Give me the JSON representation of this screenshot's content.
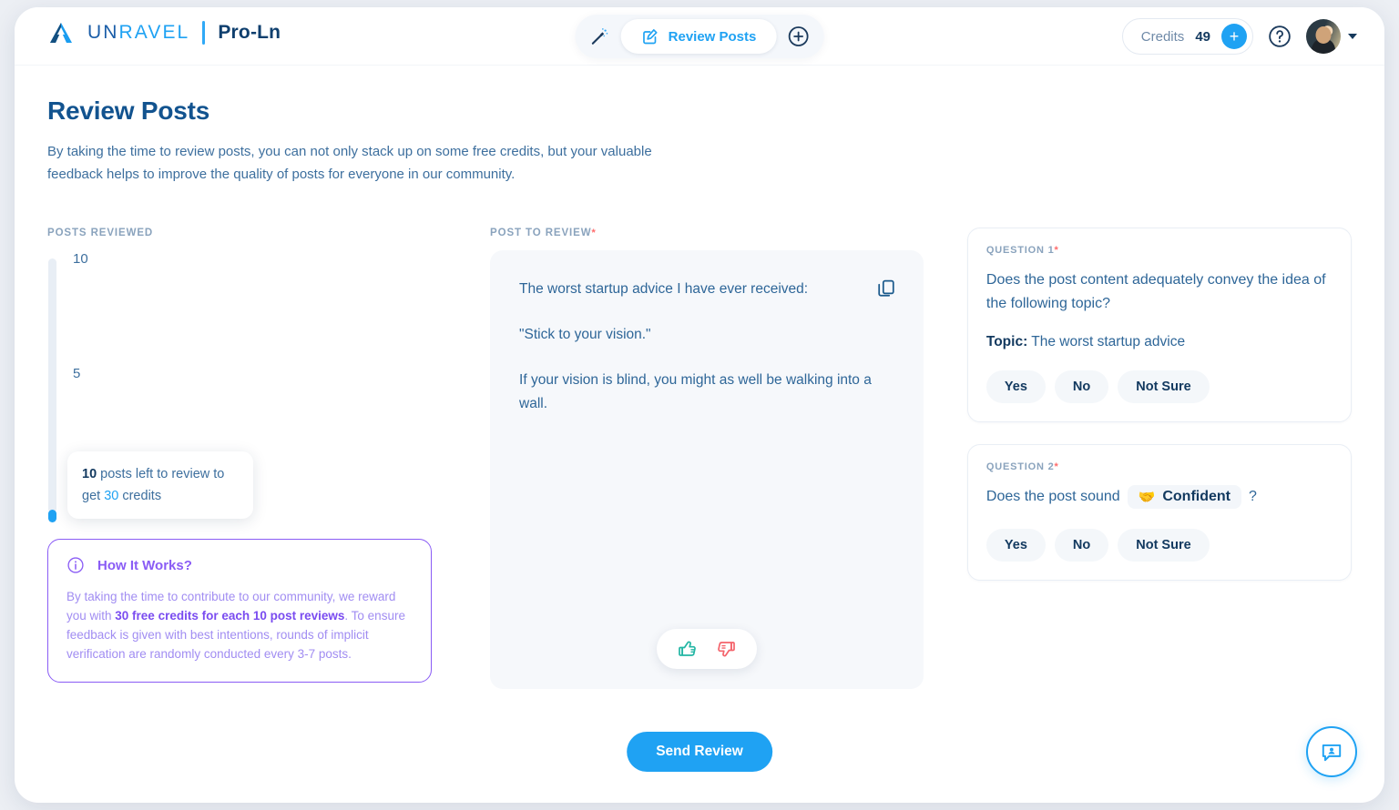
{
  "brand": {
    "word_un": "UN",
    "word_ravel": "RAVEL",
    "product": "Pro-Ln",
    "logo_icon": "unravel-logo-icon"
  },
  "header": {
    "nav": {
      "wand_icon": "magic-wand-icon",
      "tab_label": "Review Posts",
      "tab_icon": "edit-square-icon",
      "add_icon": "plus-circle-icon"
    },
    "credits": {
      "label": "Credits",
      "value": "49",
      "add_symbol": "+"
    },
    "help_icon": "question-mark-circle-icon",
    "avatar": "user-avatar",
    "caret": "chevron-down-icon"
  },
  "page": {
    "title": "Review Posts",
    "description": "By taking the time to review posts, you can not only stack up on some free credits, but your valuable feedback helps to improve the quality of posts for everyone in our community."
  },
  "left": {
    "label": "POSTS REVIEWED",
    "scale": {
      "top": "10",
      "mid": "5",
      "bottom": "0"
    },
    "tooltip": {
      "count": "10",
      "text_1": " posts left to review to get ",
      "credits": "30",
      "text_2": " credits"
    },
    "how_it_works": {
      "icon": "info-circle-icon",
      "title": "How It Works?",
      "text_1": "By taking the time to contribute to our community, we reward you with ",
      "bold": "30 free credits for each 10 post reviews",
      "text_2": ". To ensure feedback is given with best intentions, rounds of implicit verification are randomly conducted every 3-7 posts."
    }
  },
  "middle": {
    "label": "POST TO REVIEW",
    "required_mark": "*",
    "copy_icon": "copy-icon",
    "post_paragraphs": [
      "The worst startup advice I have ever received:",
      "\"Stick to your vision.\"",
      "If your vision is blind, you might as well be walking into a wall."
    ],
    "vote": {
      "up_icon": "thumbs-up-icon",
      "down_icon": "thumbs-down-icon"
    }
  },
  "questions": [
    {
      "label": "QUESTION 1",
      "required_mark": "*",
      "text": "Does the post content adequately convey the idea of the following topic?",
      "topic_label": "Topic:",
      "topic_value": " The worst startup advice",
      "options": [
        "Yes",
        "No",
        "Not Sure"
      ]
    },
    {
      "label": "QUESTION 2",
      "required_mark": "*",
      "prefix": "Does the post sound",
      "tone_emoji": "🤝",
      "tone": "Confident",
      "suffix": "?",
      "options": [
        "Yes",
        "No",
        "Not Sure"
      ]
    }
  ],
  "footer": {
    "submit_label": "Send Review",
    "chat_icon": "chat-support-icon"
  },
  "colors": {
    "accent_blue": "#1fa2f3",
    "dark_blue": "#12395f",
    "text_blue": "#2e6698",
    "purple": "#8a5cf5",
    "required_red": "#ff6b6b",
    "thumb_up_green": "#23b6a4",
    "thumb_down_red": "#f4636b"
  }
}
